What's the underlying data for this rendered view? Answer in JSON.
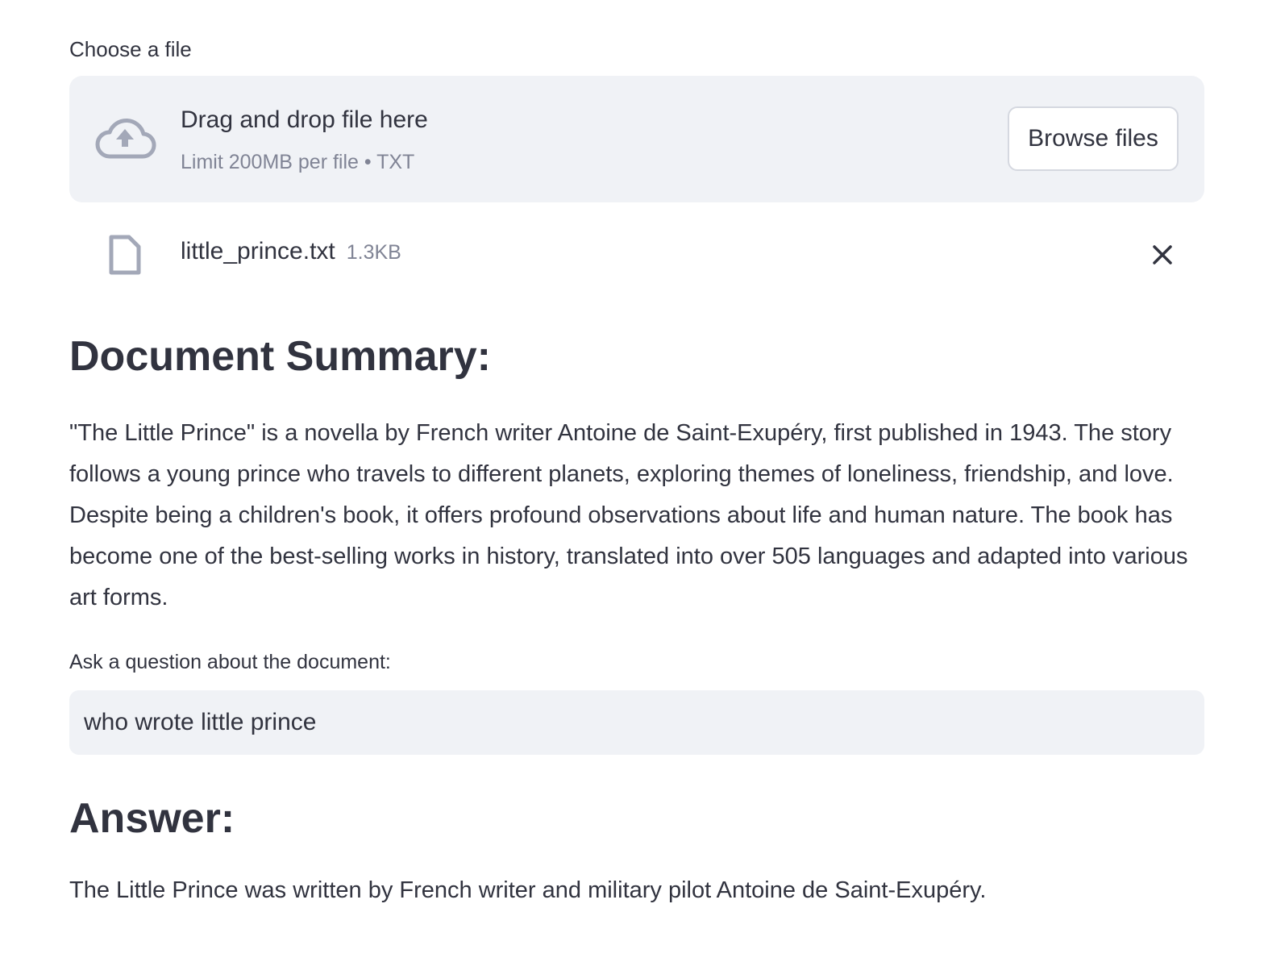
{
  "uploader": {
    "label": "Choose a file",
    "drop_title": "Drag and drop file here",
    "drop_limit": "Limit 200MB per file • TXT",
    "browse_label": "Browse files",
    "icon": "cloud-upload-icon"
  },
  "uploaded_file": {
    "name": "little_prince.txt",
    "size": "1.3KB",
    "icon": "file-icon",
    "remove_icon": "close-icon"
  },
  "summary": {
    "heading": "Document Summary:",
    "text": "\"The Little Prince\" is a novella by French writer Antoine de Saint-Exupéry, first published in 1943. The story follows a young prince who travels to different planets, exploring themes of loneliness, friendship, and love. Despite being a children's book, it offers profound observations about life and human nature. The book has become one of the best-selling works in history, translated into over 505 languages and adapted into various art forms."
  },
  "question": {
    "label": "Ask a question about the document:",
    "value": "who wrote little prince"
  },
  "answer": {
    "heading": "Answer:",
    "text": "The Little Prince was written by French writer and military pilot Antoine de Saint-Exupéry."
  },
  "colors": {
    "text": "#31333f",
    "muted": "#808495",
    "panel_bg": "#f0f2f6",
    "icon": "#a3a8b8"
  }
}
